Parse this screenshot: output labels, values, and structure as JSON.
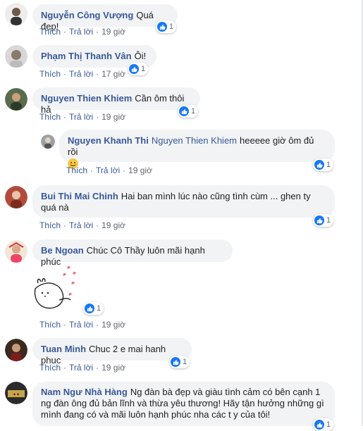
{
  "actions": {
    "like": "Thích",
    "reply": "Trả lời"
  },
  "comments": [
    {
      "name": "Nguyễn Công Vượng",
      "text": "Quá đẹp!",
      "time": "19 giờ",
      "likes": "1"
    },
    {
      "name": "Phạm Thị Thanh Vân",
      "text": "Ôi!",
      "time": "17 giờ",
      "likes": "1"
    },
    {
      "name": "Nguyen Thien Khiem",
      "text": "Cần ôm thôi hả",
      "time": "19 giờ",
      "likes": "1"
    },
    {
      "name": "Nguyen Khanh Thi",
      "mention": "Nguyen Thien Khiem",
      "text": "heeeee giờ ôm đủ rồi",
      "time": "19 giờ",
      "likes": "1"
    },
    {
      "name": "Bui Thi Mai Chinh",
      "text": "Hai ban mình lúc nào cũng tình cùm ... ghen ty quá nà",
      "time": "19 giờ",
      "likes": "1"
    },
    {
      "name": "Be Ngoan",
      "text": "Chúc Cô Thầy luôn mãi hạnh phúc",
      "time": "19 giờ",
      "likes": "1"
    },
    {
      "name": "Tuan Minh",
      "text": "Chuc 2 e mai hanh phuc",
      "time": "19 giờ",
      "likes": "1"
    },
    {
      "name": "Nam Ngư Nhà Hàng",
      "text": "Ng đàn bà đẹp và giàu tình cảm có bên cạnh 1 ng đàn ông đủ bản lĩnh và thừa yêu thương! Hãy tận hưởng những gì mình đang có và mãi luôn hạnh phúc nha các t y của tôi!",
      "likes": "1"
    }
  ],
  "colors": {
    "link": "#385898",
    "bubble": "#f2f3f5",
    "like": "#1877f2"
  }
}
